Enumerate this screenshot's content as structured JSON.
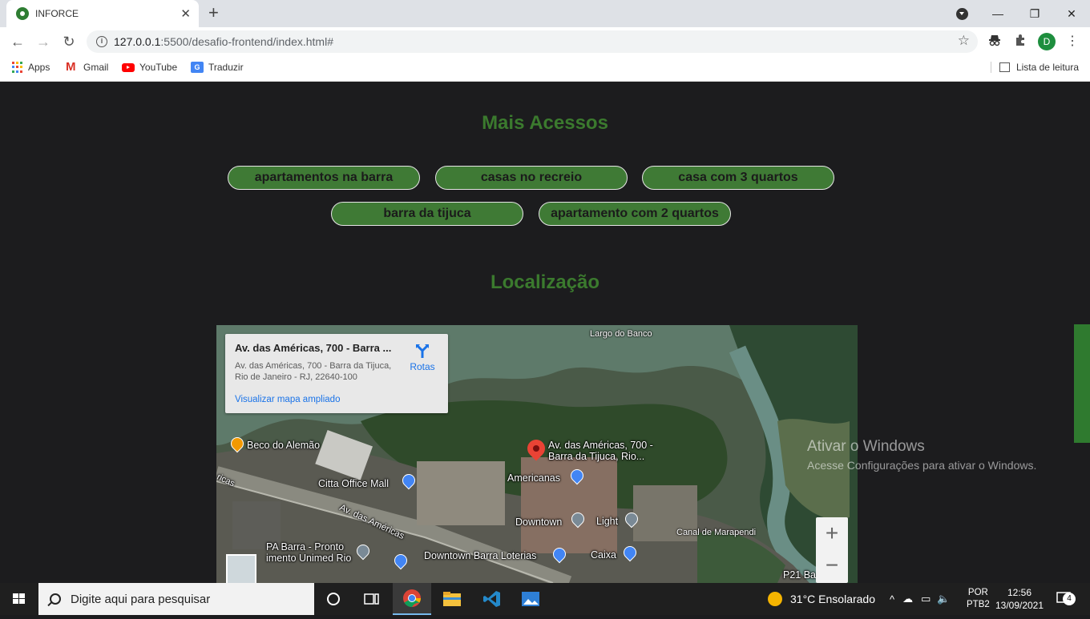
{
  "browser": {
    "tab_title": "INFORCE",
    "new_tab_label": "+",
    "url_host": "127.0.0.1",
    "url_path": ":5500/desafio-frontend/index.html#",
    "avatar_letter": "D",
    "bookmarks": [
      "Apps",
      "Gmail",
      "YouTube",
      "Traduzir"
    ],
    "reading_list": "Lista de leitura"
  },
  "page": {
    "access_title": "Mais Acessos",
    "access_links": [
      "apartamentos na barra",
      "casas no recreio",
      "casa com 3 quartos",
      "barra da tijuca",
      "apartamento com 2 quartos"
    ],
    "location_title": "Localização"
  },
  "map": {
    "card_title": "Av. das Américas, 700 - Barra ...",
    "card_address": "Av. das Américas, 700 - Barra da Tijuca, Rio de Janeiro - RJ, 22640-100",
    "card_link": "Visualizar mapa ampliado",
    "directions_label": "Rotas",
    "labels": {
      "largo": "Largo do Banco",
      "beco": "Beco do Alemão",
      "marker": "Av. das Américas, 700 - Barra da Tijuca, Rio...",
      "citta": "Citta Office Mall",
      "americanas": "Americanas",
      "downtown": "Downtown",
      "light": "Light",
      "canal": "Canal de Marapendi",
      "road": "Av. das Américas",
      "pa": "PA Barra - Pronto",
      "unimed": "imento Unimed Rio",
      "loterias": "Downtown Barra Loterias",
      "caixa": "Caixa",
      "p21": "P21 Ba",
      "ricas": "ricas"
    },
    "zoom_in": "+",
    "zoom_out": "−"
  },
  "watermark": {
    "line1": "Ativar o Windows",
    "line2": "Acesse Configurações para ativar o Windows."
  },
  "taskbar": {
    "search_placeholder": "Digite aqui para pesquisar",
    "weather": "31°C  Ensolarado",
    "lang1": "POR",
    "lang2": "PTB2",
    "time": "12:56",
    "date": "13/09/2021",
    "notifications": "4"
  },
  "colors": {
    "heading": "#3b7a2e",
    "pill_bg": "#3f7a35",
    "page_bg": "#1c1c1e"
  }
}
